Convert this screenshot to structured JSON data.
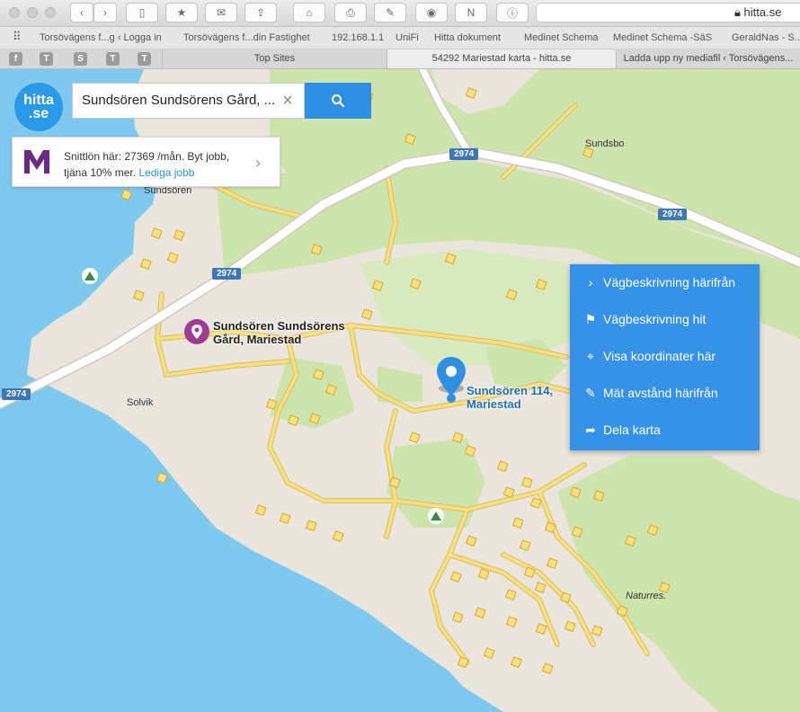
{
  "browser": {
    "url": "hitta.se",
    "bookmarks": [
      "Torsövägens f...g ‹ Logga in",
      "Torsövägens f...din Fastighet",
      "192.168.1.1",
      "UniFi",
      "Hitta dokument",
      "Medinet Schema",
      "Medinet Schema -SäS",
      "GeraldNas - S..."
    ],
    "pinned_tabs": [
      "f",
      "T",
      "S",
      "T",
      "T"
    ],
    "tabs": [
      "Top Sites",
      "54292 Mariestad karta - hitta.se",
      "Ladda upp ny mediafil ‹ Torsövägens..."
    ]
  },
  "app": {
    "logo_line1": "hitta",
    "logo_line2": ".se",
    "search_value": "Sundsören Sundsörens Gård, ...",
    "clear_glyph": "×"
  },
  "ad": {
    "line1": "Snittlön här: 27369 /mån. Byt jobb,",
    "line2": "tjäna 10% mer. ",
    "link": "Lediga jobb",
    "chevron": "›"
  },
  "map": {
    "road_number": "2974",
    "places": {
      "sundsoren": "Sundsören",
      "sundsbo": "Sundsbo",
      "solvik": "Solvik",
      "naturres": "Naturres."
    },
    "poi_line1": "Sundsören Sundsörens",
    "poi_line2": "Gård, Mariestad",
    "address_line1": "Sundsören 114,",
    "address_line2": "Mariestad",
    "colors": {
      "water": "#7fc9ee",
      "forest": "#cde5ad",
      "land": "#eae6de",
      "road_fill": "#fbe07c",
      "marker_blue": "#2f8fe3",
      "marker_purple": "#a03a94",
      "menu_blue": "#3592e6"
    }
  },
  "context_menu": [
    {
      "icon": "chevron-right-icon",
      "glyph": "›",
      "label": "Vägbeskrivning härifrån"
    },
    {
      "icon": "flag-icon",
      "glyph": "⚑",
      "label": "Vägbeskrivning hit"
    },
    {
      "icon": "crosshair-icon",
      "glyph": "⌖",
      "label": "Visa koordinater här"
    },
    {
      "icon": "ruler-icon",
      "glyph": "✎",
      "label": "Mät avstånd härifrån"
    },
    {
      "icon": "share-icon",
      "glyph": "➦",
      "label": "Dela karta"
    }
  ]
}
